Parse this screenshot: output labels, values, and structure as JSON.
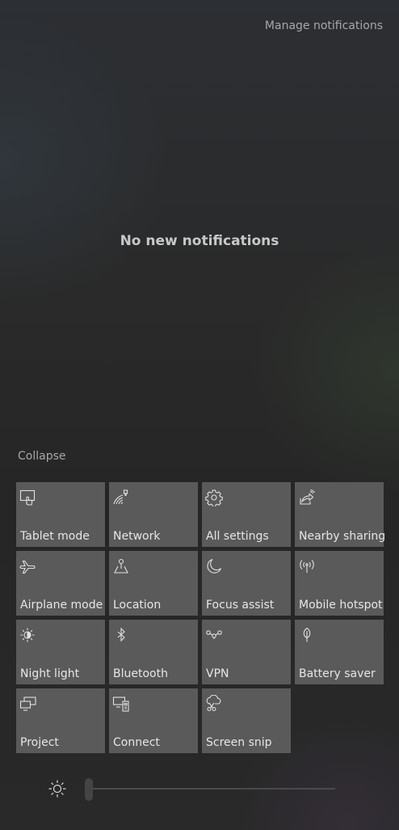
{
  "header": {
    "manage_label": "Manage notifications"
  },
  "notifications": {
    "empty_message": "No new notifications"
  },
  "collapse_label": "Collapse",
  "quick_actions": [
    {
      "label": "Tablet mode",
      "icon": "tablet-mode-icon"
    },
    {
      "label": "Network",
      "icon": "network-icon"
    },
    {
      "label": "All settings",
      "icon": "gear-icon"
    },
    {
      "label": "Nearby sharing",
      "icon": "nearby-sharing-icon"
    },
    {
      "label": "Airplane mode",
      "icon": "airplane-icon"
    },
    {
      "label": "Location",
      "icon": "location-icon"
    },
    {
      "label": "Focus assist",
      "icon": "moon-icon"
    },
    {
      "label": "Mobile hotspot",
      "icon": "hotspot-icon"
    },
    {
      "label": "Night light",
      "icon": "night-light-icon"
    },
    {
      "label": "Bluetooth",
      "icon": "bluetooth-icon"
    },
    {
      "label": "VPN",
      "icon": "vpn-icon"
    },
    {
      "label": "Battery saver",
      "icon": "leaf-icon"
    },
    {
      "label": "Project",
      "icon": "project-icon"
    },
    {
      "label": "Connect",
      "icon": "connect-icon"
    },
    {
      "label": "Screen snip",
      "icon": "screen-snip-icon"
    }
  ],
  "brightness": {
    "icon": "sun-icon",
    "level": 0
  },
  "colors": {
    "tile_bg": "#5a5a5a",
    "tile_text": "#e6e6e6",
    "link_text": "#a7a7a7",
    "message_text": "#c8c8c8"
  }
}
